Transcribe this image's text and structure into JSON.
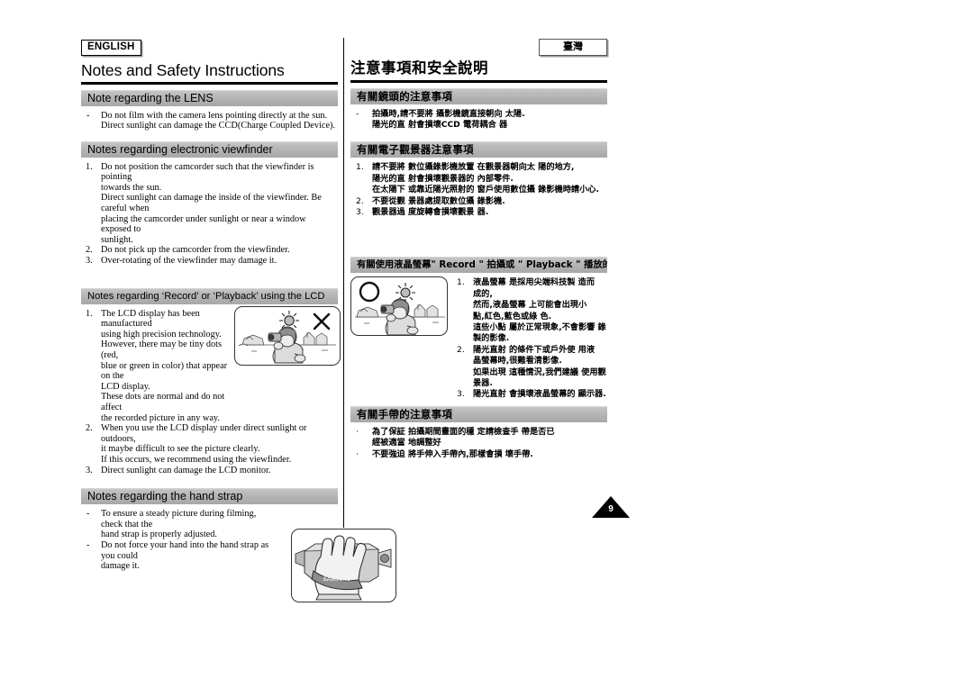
{
  "page": {
    "number": "9"
  },
  "english": {
    "lang_badge": "ENGLISH",
    "title": "Notes and Safety Instructions",
    "sections": [
      {
        "heading": "Note regarding the LENS",
        "items": [
          {
            "marker": "-",
            "lines": [
              "Do not film with the camera lens pointing directly at the sun.",
              "Direct sunlight can damage the CCD(Charge Coupled Device)."
            ]
          }
        ]
      },
      {
        "heading": "Notes regarding electronic viewfinder",
        "items": [
          {
            "marker": "1.",
            "lines": [
              "Do not position the camcorder such that the viewfinder is pointing",
              "towards the sun.",
              "Direct sunlight can damage the inside of the viewfinder. Be careful when",
              "placing the camcorder under sunlight or near a window exposed to",
              "sunlight."
            ]
          },
          {
            "marker": "2.",
            "lines": [
              "Do not pick up the camcorder from the viewfinder."
            ]
          },
          {
            "marker": "3.",
            "lines": [
              "Over-rotating of the viewfinder may damage it."
            ]
          }
        ]
      },
      {
        "heading": "Notes regarding ‘Record’ or ‘Playback’ using the LCD",
        "items": [
          {
            "marker": "1.",
            "lines": [
              "The LCD display has been manufactured",
              "using high precision technology.",
              "However, there may be tiny dots (red,",
              "blue or green in color) that appear on the",
              "LCD display.",
              "These dots are normal and do not affect",
              "the recorded picture in any way."
            ]
          },
          {
            "marker": "2.",
            "lines": [
              "When you use the LCD display under direct sunlight or outdoors,",
              "it maybe difficult to see the picture clearly.",
              "If this occurs, we recommend using the viewfinder."
            ]
          },
          {
            "marker": "3.",
            "lines": [
              "Direct sunlight can damage the LCD monitor."
            ]
          }
        ]
      },
      {
        "heading": "Notes regarding the hand strap",
        "items": [
          {
            "marker": "-",
            "lines": [
              "To ensure a steady picture during filming, check that the",
              "hand strap is properly adjusted."
            ]
          },
          {
            "marker": "-",
            "lines": [
              "Do not force your hand into the hand strap as you could",
              "damage it."
            ]
          }
        ]
      }
    ]
  },
  "chinese": {
    "lang_badge": "臺灣",
    "title": "注意事項和安全說明",
    "sections": [
      {
        "heading": "有關鏡頭的注意事項",
        "items": [
          {
            "marker": "-",
            "lines": [
              "拍攝時,請不要將 攝影機鏡直接朝向 太陽.",
              "陽光的直 射會損壞CCD 電荷耦合 器"
            ]
          }
        ]
      },
      {
        "heading": "有關電子觀景器注意事項",
        "items": [
          {
            "marker": "1.",
            "lines": [
              "請不要將 數位攝錄影機放置 在觀景器朝向太 陽的地方,",
              "陽光的直 射會損壞觀景器的 內部零件.",
              "在太陽下 或靠近陽光照射的 窗戶使用數位攝 錄影機時請小心."
            ]
          },
          {
            "marker": "2.",
            "lines": [
              "不要從觀 景器處提取數位攝 錄影機."
            ]
          },
          {
            "marker": "3.",
            "lines": [
              "觀景器過 度旋轉會損壞觀景 器."
            ]
          }
        ]
      },
      {
        "heading": "有關使用液晶螢幕\" Record \" 拍攝或 \" Playback \" 播放的注意事項",
        "items": [
          {
            "marker": "1.",
            "lines": [
              "液晶螢幕 是採用尖端科技製 造而",
              "成的,",
              "然而,液晶螢幕 上可能會出現小",
              "點,紅色,藍色或綠 色.",
              "這些小點 屬於正常現象,不會影響 錄",
              "製的影像."
            ]
          },
          {
            "marker": "2.",
            "lines": [
              "陽光直射 的條件下或戶外使 用液",
              "晶螢幕時,很難看清影像.",
              "如果出現 這種情況,我們建議 使用觀",
              "景器."
            ]
          },
          {
            "marker": "3.",
            "lines": [
              "陽光直射 會損壞液晶螢幕的 顯示器."
            ]
          }
        ]
      },
      {
        "heading": "有關手帶的注意事項",
        "items": [
          {
            "marker": "·",
            "lines": [
              "為了保証 拍攝期間畫面的穩 定請檢查手 帶是否已",
              "經被適當 地調整好"
            ]
          },
          {
            "marker": "·",
            "lines": [
              "不要強迫 將手伸入手帶內,那樣會損 壞手帶."
            ]
          }
        ]
      }
    ]
  },
  "figures": {
    "lcd_en": {
      "name": "person-filming-toward-sun-forbidden",
      "overlay_symbol": "cross-mark"
    },
    "lcd_zh": {
      "name": "person-filming-toward-sun-allowed",
      "overlay_symbol": "circle-mark"
    },
    "hand_strap": {
      "name": "hand-holding-camcorder-with-strap",
      "strap_label": "SAMSUNG"
    }
  },
  "colors": {
    "section_bar": "#b1b1b1",
    "rule": "#000000",
    "figure_fill": "#e8e8e8"
  }
}
